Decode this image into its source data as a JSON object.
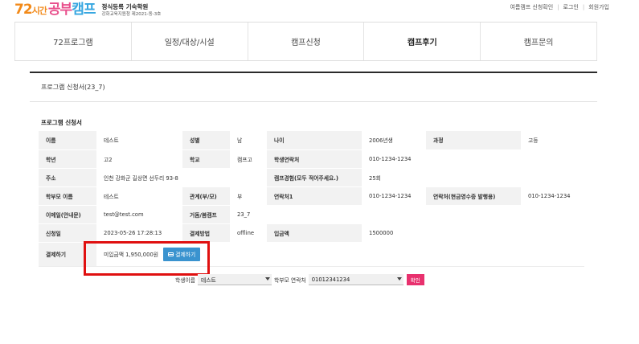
{
  "header": {
    "logo": {
      "num": "72",
      "si": "시간",
      "gongbu": "공부",
      "camp": "캠프"
    },
    "title": "정식등록 기숙학원",
    "subtitle": "강화교육지원청 제2021-동-3호",
    "links": [
      "여름캠프 신청확인",
      "로그인",
      "회원가입"
    ]
  },
  "nav": [
    "72프로그램",
    "일정/대상/시설",
    "캠프신청",
    "캠프후기",
    "캠프문의"
  ],
  "page": {
    "title": "프로그램 신청서(23_7)",
    "section": "프로그램 신청서"
  },
  "form": {
    "rows": [
      {
        "l1": "이름",
        "v1": "테스트",
        "l2": "성별",
        "v2": "남",
        "l3": "나이",
        "v3": "2006년생",
        "l4": "과정",
        "v4": "고등"
      },
      {
        "l1": "학년",
        "v1": "고2",
        "l2": "학교",
        "v2": "캠프고",
        "l3": "학생연락처",
        "v3": "010-1234-1234"
      },
      {
        "l1": "주소",
        "v1": "인천 강화군 길상면 선두리 93-8",
        "l3": "캠프경험(모두 적어주세요.)",
        "v3": "25회"
      },
      {
        "l1": "학부모 이름",
        "v1": "테스트",
        "l2": "관계(부/모)",
        "v2": "부",
        "l3": "연락처1",
        "v3": "010-1234-1234",
        "l4": "연락처(현금영수증 발행용)",
        "v4": "010-1234-1234"
      },
      {
        "l1": "이메일(안내문)",
        "v1": "test@test.com",
        "l2": "거돔/봄캠프",
        "v2": "23_7"
      },
      {
        "l1": "신청일",
        "v1": "2023-05-26 17:28:13",
        "l2": "결제방법",
        "v2": "offline",
        "l3": "입금액",
        "v3": "1500000"
      },
      {
        "l1": "결제하기",
        "v1": "미입금액 1,950,000원"
      }
    ],
    "pay_button": "결제하기"
  },
  "search": {
    "student_label": "학생이름",
    "student_value": "테스트",
    "parent_label": "학부모 연락처",
    "parent_value": "01012341234",
    "ok": "확인"
  },
  "colors": {
    "accent_blue": "#3a93cf",
    "highlight": "#e01010",
    "ok_pink": "#e8316e"
  }
}
